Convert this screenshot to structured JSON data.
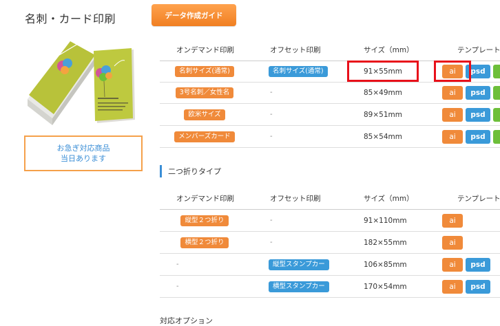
{
  "page": {
    "title": "名刺・カード印刷",
    "guide_button": "データ作成ガイド",
    "notice_lines": [
      "お急ぎ対応商品",
      "当日あります"
    ],
    "section_title": "二つ折りタイプ",
    "options_title": "対応オプション"
  },
  "table_headers": [
    "オンデマンド印刷",
    "オフセット印刷",
    "サイズ（mm）",
    "テンプレート"
  ],
  "table1": [
    {
      "ondemand": "名刺サイズ(通常)",
      "offset": "名刺サイズ(通常)",
      "size": "91×55mm",
      "templates": [
        "ai",
        "psd"
      ]
    },
    {
      "ondemand": "3号名刺／女性名",
      "offset": "-",
      "size": "85×49mm",
      "templates": [
        "ai",
        "psd"
      ]
    },
    {
      "ondemand": "欧米サイズ",
      "offset": "-",
      "size": "89×51mm",
      "templates": [
        "ai",
        "psd"
      ]
    },
    {
      "ondemand": "メンバーズカード",
      "offset": "-",
      "size": "85×54mm",
      "templates": [
        "ai",
        "psd"
      ]
    }
  ],
  "table2": [
    {
      "ondemand": "縦型２つ折り",
      "offset": "-",
      "size": "91×110mm",
      "templates": [
        "ai"
      ]
    },
    {
      "ondemand": "横型２つ折り",
      "offset": "-",
      "size": "182×55mm",
      "templates": [
        "ai"
      ]
    },
    {
      "ondemand": "-",
      "offset": "縦型スタンプカー",
      "size": "106×85mm",
      "templates": [
        "ai",
        "psd"
      ]
    },
    {
      "ondemand": "-",
      "offset": "横型スタンプカー",
      "size": "170×54mm",
      "templates": [
        "ai",
        "psd"
      ]
    }
  ],
  "colors": {
    "orange": "#f08a3a",
    "blue": "#3a9ad9",
    "green": "#6dbf3a",
    "highlight": "#e8101a",
    "notice_border": "#f5a04a"
  }
}
